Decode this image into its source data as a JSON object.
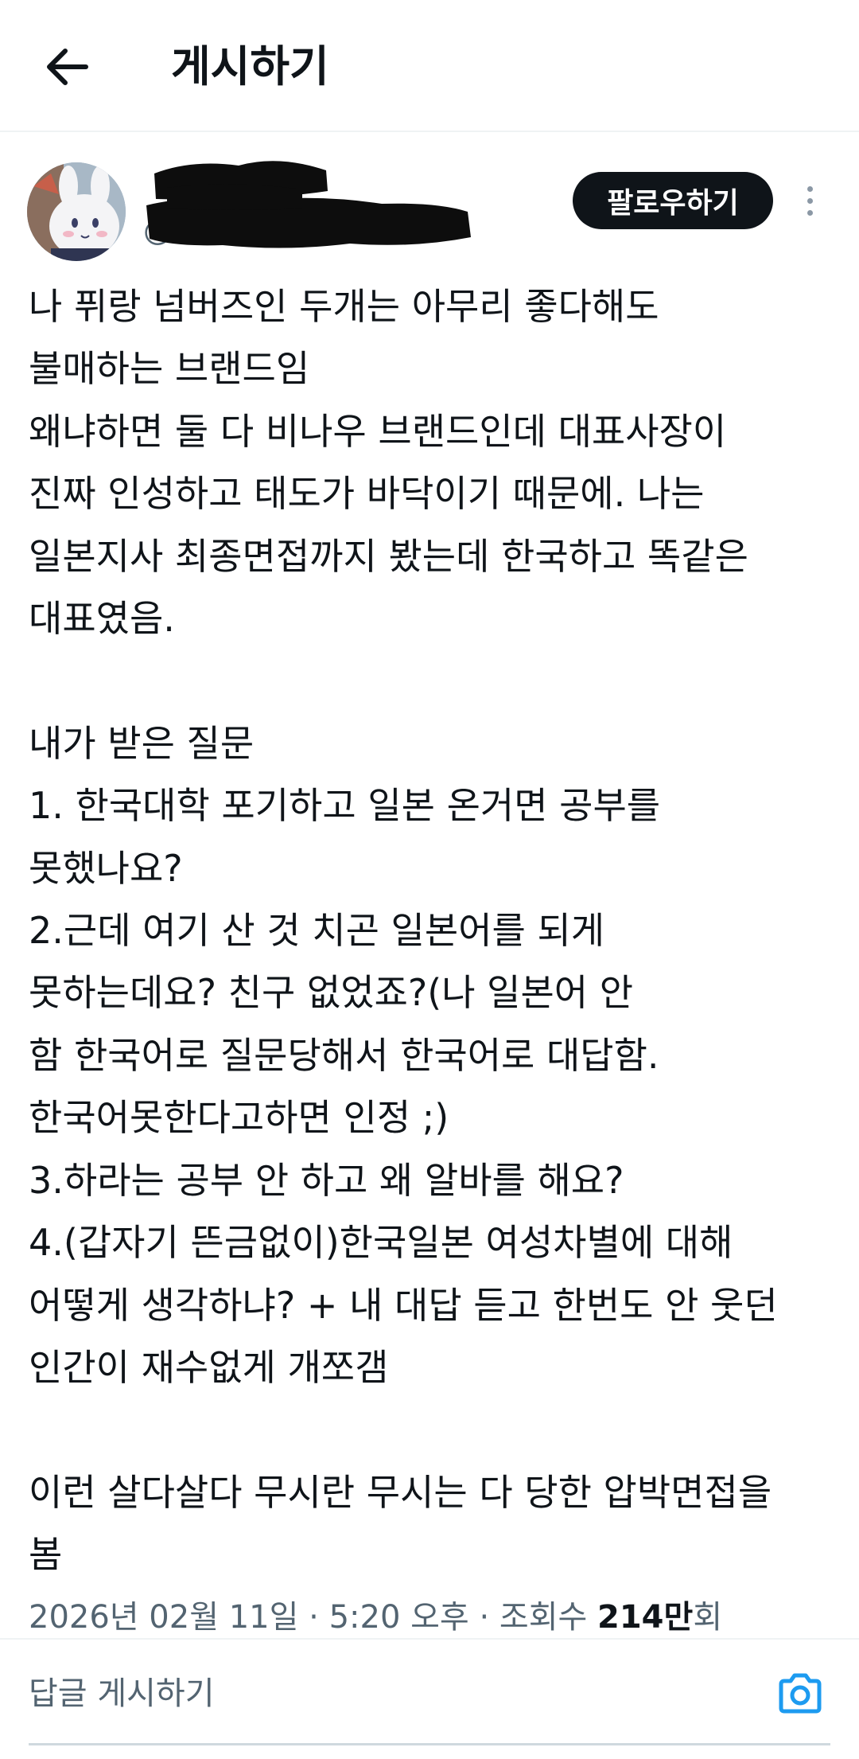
{
  "header": {
    "title": "게시하기"
  },
  "author": {
    "display_name": "",
    "handle": "@",
    "follow_label": "팔로우하기"
  },
  "post": {
    "text": "나 퓌랑 넘버즈인 두개는 아무리 좋다해도\n불매하는 브랜드임\n왜냐하면 둘 다 비나우 브랜드인데 대표사장이\n진짜 인성하고 태도가 바닥이기 때문에. 나는\n일본지사 최종면접까지 봤는데 한국하고 똑같은\n대표였음.\n\n내가 받은 질문\n1. 한국대학 포기하고 일본 온거면 공부를\n못했나요?\n2.근데 여기 산 것 치곤 일본어를 되게\n못하는데요? 친구 없었죠?(나 일본어 안\n함 한국어로 질문당해서 한국어로 대답함.\n한국어못한다고하면 인정 ;)\n3.하라는 공부 안 하고 왜 알바를 해요?\n4.(갑자기 뜬금없이)한국일본 여성차별에 대해\n어떻게 생각하냐? + 내 대답 듣고 한번도 안 웃던\n인간이 재수없게 개쪼갬\n\n이런 살다살다 무시란 무시는 다 당한 압박면접을\n봄",
    "meta": {
      "date": "2026년 02월 11일",
      "time": "5:20 오후",
      "views_label": "조회수",
      "views_count": "214만",
      "views_suffix": "회"
    }
  },
  "reply": {
    "placeholder": "답글 게시하기"
  },
  "colors": {
    "accent": "#1d9bf0",
    "text": "#0f1419",
    "secondary": "#536471",
    "divider": "#eff3f4"
  },
  "icons": {
    "back": "arrow-left-icon",
    "more": "more-vertical-icon",
    "camera": "camera-icon",
    "verified": "verified-badge-icon"
  }
}
